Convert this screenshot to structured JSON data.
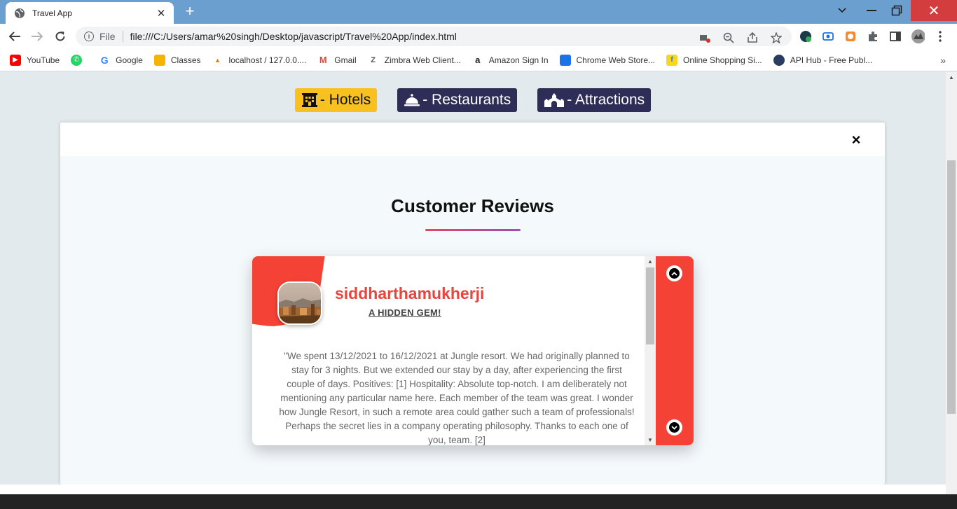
{
  "browser": {
    "tab_title": "Travel App",
    "url_scheme": "File",
    "url": "file:///C:/Users/amar%20singh/Desktop/javascript/Travel%20App/index.html",
    "bookmarks": [
      {
        "label": "YouTube",
        "icon": "youtube-icon",
        "color": "#ff0000"
      },
      {
        "label": "",
        "icon": "whatsapp-icon",
        "color": "#25d366"
      },
      {
        "label": "Google",
        "icon": "google-icon",
        "color": "#4285f4"
      },
      {
        "label": "Classes",
        "icon": "classroom-icon",
        "color": "#f4b400"
      },
      {
        "label": "localhost / 127.0.0....",
        "icon": "phpmyadmin-icon",
        "color": "#e07b00"
      },
      {
        "label": "Gmail",
        "icon": "gmail-icon",
        "color": "#ea4335"
      },
      {
        "label": "Zimbra Web Client...",
        "icon": "zimbra-icon",
        "color": "#555555"
      },
      {
        "label": "Amazon Sign In",
        "icon": "amazon-icon",
        "color": "#222222"
      },
      {
        "label": "Chrome Web Store...",
        "icon": "chrome-webstore-icon",
        "color": "#1a73e8"
      },
      {
        "label": "Online Shopping Si...",
        "icon": "flipkart-icon",
        "color": "#f9d71c"
      },
      {
        "label": "API Hub - Free Publ...",
        "icon": "apihub-icon",
        "color": "#2b3c63"
      }
    ]
  },
  "categories": [
    {
      "label": "- Hotels",
      "icon": "hotel-icon",
      "active": true
    },
    {
      "label": "- Restaurants",
      "icon": "restaurant-bell-icon",
      "active": false
    },
    {
      "label": "- Attractions",
      "icon": "attraction-icon",
      "active": false
    }
  ],
  "modal": {
    "close_label": "×",
    "heading": "Customer Reviews"
  },
  "review": {
    "username": "siddharthamukherji",
    "title": "A HIDDEN GEM!",
    "text": "\"We spent 13/12/2021 to 16/12/2021 at Jungle resort. We had originally planned to stay for 3 nights. But we extended our stay by a day, after experiencing the first couple of days. Positives: [1] Hospitality: Absolute top-notch. I am deliberately not mentioning any particular name here. Each member of the team was great. I wonder how Jungle Resort, in such a remote area could gather such a team of professionals! Perhaps the secret lies in a company operating philosophy. Thanks to each one of you, team. [2]"
  },
  "colors": {
    "accent_red": "#f44336",
    "nav_dark": "#2e2d57",
    "nav_active": "#f9c11f"
  }
}
